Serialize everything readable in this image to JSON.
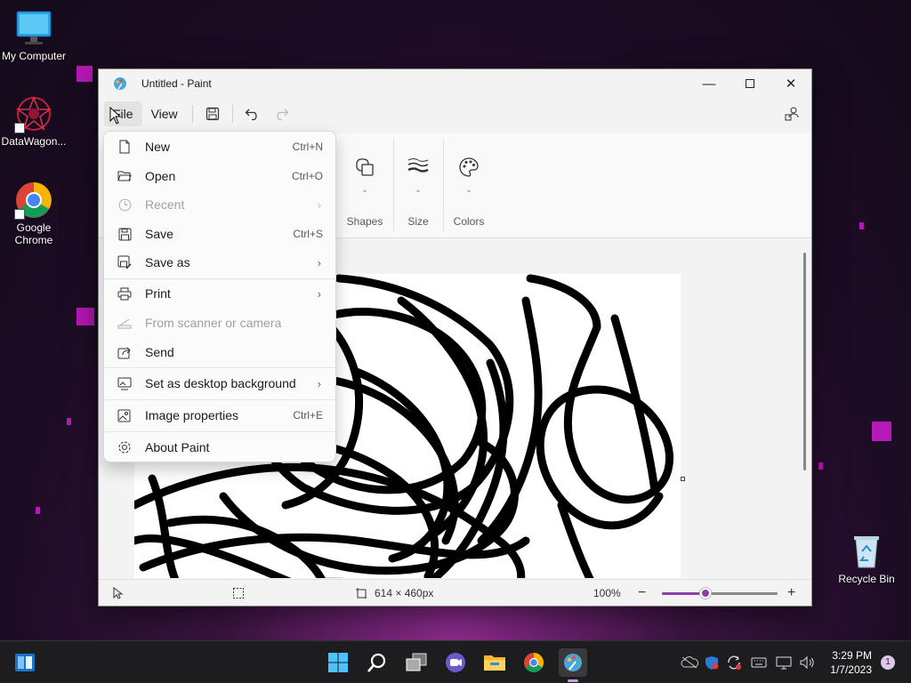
{
  "desktop": {
    "icons": [
      {
        "label": "My Computer"
      },
      {
        "label": "DataWagon..."
      },
      {
        "label": "Google Chrome"
      },
      {
        "label": "Recycle Bin"
      }
    ]
  },
  "window": {
    "title": "Untitled - Paint",
    "menu": {
      "file": "File",
      "view": "View"
    },
    "ribbon": {
      "shapes": "Shapes",
      "size": "Size",
      "colors": "Colors"
    },
    "status": {
      "dimensions": "614 × 460px",
      "zoom": "100%",
      "zoom_level": 0.38
    }
  },
  "file_menu": {
    "items": [
      {
        "label": "New",
        "shortcut": "Ctrl+N"
      },
      {
        "label": "Open",
        "shortcut": "Ctrl+O"
      },
      {
        "label": "Recent"
      },
      {
        "label": "Save",
        "shortcut": "Ctrl+S"
      },
      {
        "label": "Save as"
      },
      {
        "label": "Print"
      },
      {
        "label": "From scanner or camera"
      },
      {
        "label": "Send"
      },
      {
        "label": "Set as desktop background"
      },
      {
        "label": "Image properties",
        "shortcut": "Ctrl+E"
      },
      {
        "label": "About Paint"
      }
    ]
  },
  "taskbar": {
    "time": "3:29 PM",
    "date": "1/7/2023",
    "notifications": "1"
  },
  "colors": {
    "accent": "#8e3ea8",
    "taskbar": "#1d1d20",
    "menu_bg": "#fbfbfb"
  }
}
